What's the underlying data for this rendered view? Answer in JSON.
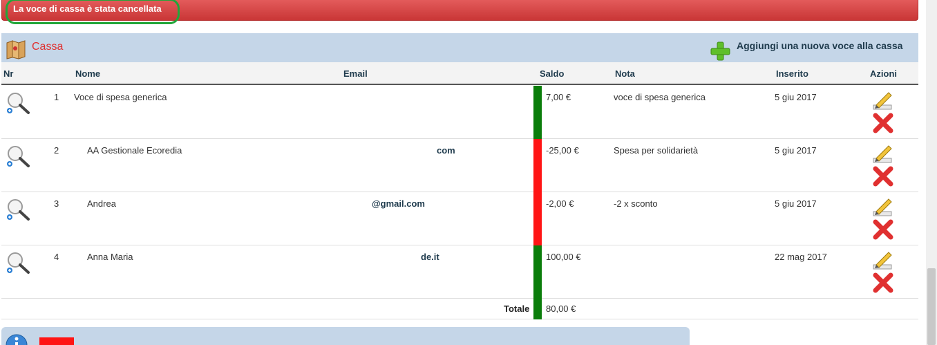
{
  "notification": {
    "text": "La voce di cassa è stata cancellata"
  },
  "panel": {
    "title": "Cassa",
    "add_label": "Aggiungi una nuova voce alla cassa"
  },
  "columns": {
    "nr": "Nr",
    "nome": "Nome",
    "email": "Email",
    "saldo": "Saldo",
    "nota": "Nota",
    "inserito": "Inserito",
    "azioni": "Azioni"
  },
  "rows": [
    {
      "nr": "1",
      "nome": "Voce di spesa generica",
      "email": "",
      "saldo": "7,00 €",
      "nota": "voce di spesa generica",
      "inserito": "5 giu 2017",
      "status": "positive"
    },
    {
      "nr": "2",
      "nome": "AA Gestionale Ecoredia",
      "email": "com",
      "saldo": "-25,00 €",
      "nota": "Spesa per solidarietà",
      "inserito": "5 giu 2017",
      "status": "negative"
    },
    {
      "nr": "3",
      "nome": "Andrea",
      "email": "@gmail.com",
      "saldo": "-2,00 €",
      "nota": "-2 x sconto",
      "inserito": "5 giu 2017",
      "status": "negative"
    },
    {
      "nr": "4",
      "nome": "Anna Maria",
      "email": "de.it",
      "saldo": "100,00 €",
      "nota": "",
      "inserito": "22 mag 2017",
      "status": "positive"
    }
  ],
  "total": {
    "label": "Totale",
    "value": "80,00 €"
  },
  "colors": {
    "positive": "#0a7d0a",
    "negative": "#ff1414",
    "header_bg": "#c5d6e8",
    "alert": "#d9403f"
  },
  "icons": {
    "view": "magnifier-icon",
    "edit": "pencil-icon",
    "delete": "delete-x-icon",
    "add": "green-plus-icon",
    "section": "map-icon",
    "info": "info-icon"
  }
}
